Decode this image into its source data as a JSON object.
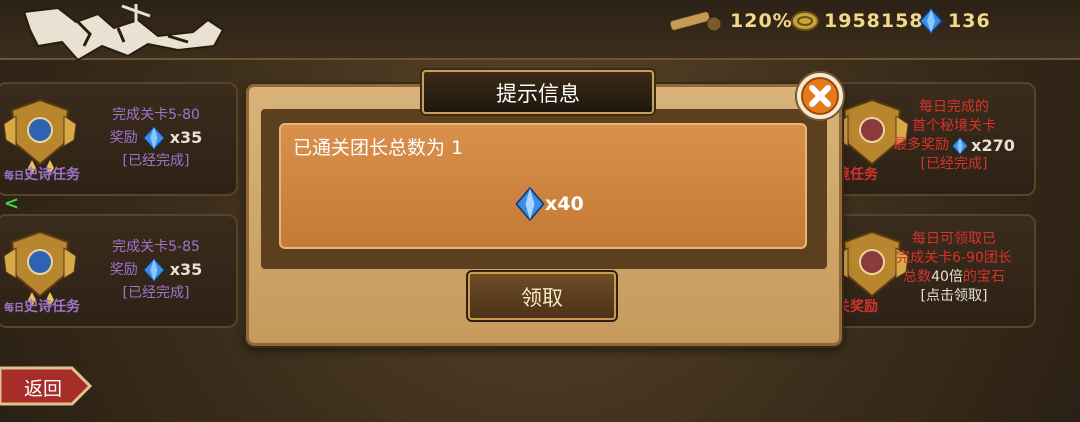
{
  "resources": {
    "energy": "120%",
    "gold": "1958158",
    "gems": "136"
  },
  "cards_left": [
    {
      "line1": "完成关卡5-80",
      "line2_label": "奖励",
      "amount": "x35",
      "status": "[已经完成]",
      "tag_small": "每日",
      "tag": "史诗任务"
    },
    {
      "line1": "完成关卡5-85",
      "line2_label": "奖励",
      "amount": "x35",
      "status": "[已经完成]",
      "tag_small": "每日",
      "tag": "史诗任务"
    }
  ],
  "cards_right": [
    {
      "line1": "每日完成的",
      "line2": "首个秘境关卡",
      "line3_label": "最多奖励",
      "amount": "x270",
      "status": "[已经完成]",
      "tag": "境任务"
    },
    {
      "line1": "每日可领取已",
      "line2": "完成关卡6-90团长",
      "line3a": "总数",
      "line3b": "40倍",
      "line3c": "的宝石",
      "status": "[点击领取]",
      "tag": "关奖励"
    }
  ],
  "nav": {
    "back": "返回",
    "left_arrow": "<"
  },
  "dialog": {
    "title": "提示信息",
    "message": "已通关团长总数为 1",
    "reward_amount": "x40",
    "claim_label": "领取",
    "close_icon": "close-icon"
  },
  "colors": {
    "purple_text": "#9f73c9",
    "red_text": "#d6332b",
    "gem": "#3a8ee8"
  }
}
